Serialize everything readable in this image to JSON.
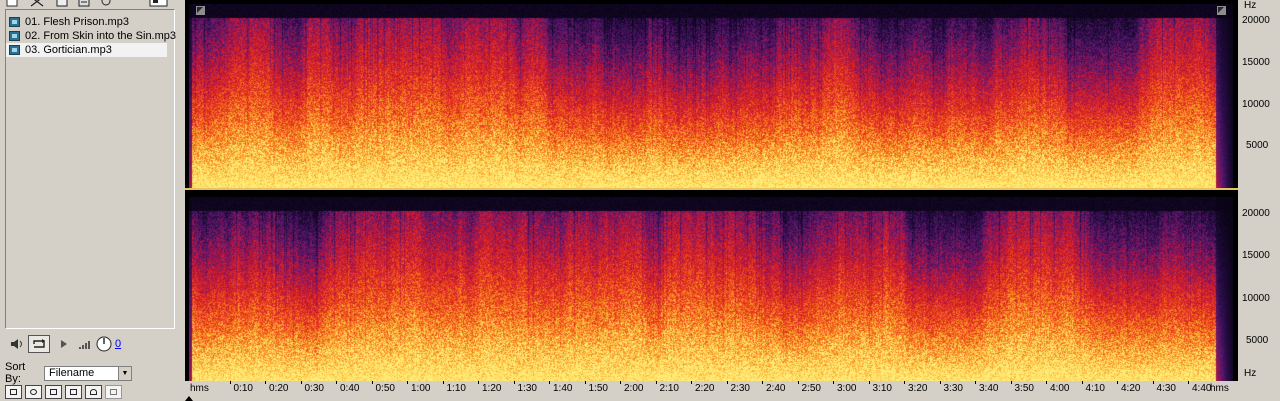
{
  "files": [
    {
      "label": "01. Flesh Prison.mp3",
      "selected": false
    },
    {
      "label": "02. From Skin into the Sin.mp3",
      "selected": false
    },
    {
      "label": "03. Gortician.mp3",
      "selected": true
    }
  ],
  "player": {
    "volume_value": "0",
    "play_icon": "play-icon",
    "speaker_icon": "speaker-icon",
    "loop_icon": "loop-icon"
  },
  "sort": {
    "label": "Sort By:",
    "value": "Filename"
  },
  "toolbar_icons": [
    "open-icon",
    "cut-icon",
    "save-icon",
    "print-icon",
    "refresh-icon",
    "view-icon"
  ],
  "bottom_icons": [
    "button-1-icon",
    "button-2-icon",
    "button-3-icon",
    "button-4-icon",
    "filter-icon",
    "button-6-icon"
  ],
  "hz_axis": {
    "unit": "Hz",
    "ticks": [
      "20000",
      "15000",
      "10000",
      "5000"
    ]
  },
  "time_axis": {
    "start_label": "hms",
    "end_label": "hms",
    "labels": [
      "0:10",
      "0:20",
      "0:30",
      "0:40",
      "0:50",
      "1:00",
      "1:10",
      "1:20",
      "1:30",
      "1:40",
      "1:50",
      "2:00",
      "2:10",
      "2:20",
      "2:30",
      "2:40",
      "2:50",
      "3:00",
      "3:10",
      "3:20",
      "3:30",
      "3:40",
      "3:50",
      "4:00",
      "4:10",
      "4:20",
      "4:30",
      "4:40"
    ]
  },
  "colors": {
    "spectro_low": "#ffe066",
    "spectro_mid": "#e8321c",
    "spectro_high": "#4a1a6a",
    "background": "#000000",
    "panel": "#d4d0c8"
  }
}
